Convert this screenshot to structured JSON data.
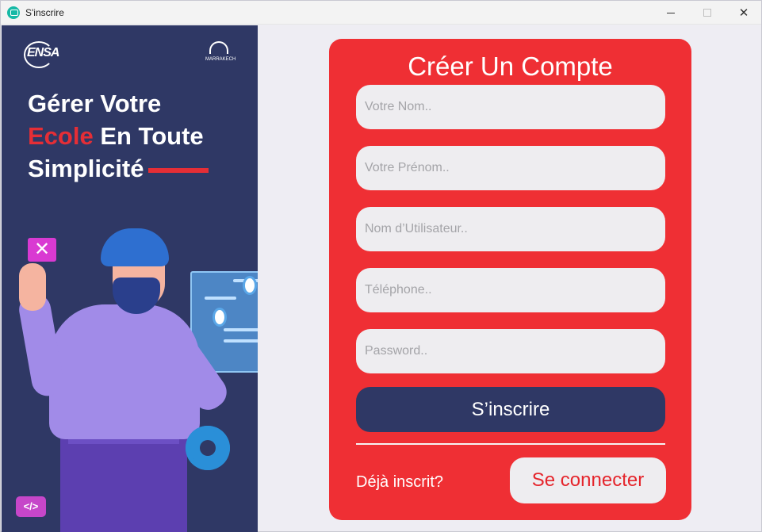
{
  "window": {
    "title": "S'inscrire",
    "icon": "app-logo-icon",
    "controls": {
      "minimize": "minimize-icon",
      "maximize": "maximize-icon",
      "close": "✕"
    }
  },
  "promo": {
    "logo_left_text": "ENSA",
    "logo_right_text": "MARRAKECH",
    "headline_line1": "Gérer Votre",
    "headline_line2_red": "Ecole",
    "headline_line2_rest": " En Toute",
    "headline_line3": "Simplicité",
    "x_icon": "✕",
    "code_icon": "</>",
    "colors": {
      "background": "#2f3865",
      "accent": "#e52e36"
    }
  },
  "form": {
    "title": "Créer Un Compte",
    "fields": [
      {
        "name": "nom",
        "placeholder": "Votre Nom.."
      },
      {
        "name": "prenom",
        "placeholder": "Votre Prénom.."
      },
      {
        "name": "utilisateur",
        "placeholder": "Nom d’Utilisateur.."
      },
      {
        "name": "telephone",
        "placeholder": "Téléphone.."
      },
      {
        "name": "password",
        "placeholder": "Password.."
      }
    ],
    "signup_button": "S’inscrire",
    "already_text": "Déjà inscrit?",
    "login_button": "Se connecter",
    "colors": {
      "card": "#ef2f34",
      "primary_button": "#2f3865",
      "field": "#eeedf0"
    }
  }
}
